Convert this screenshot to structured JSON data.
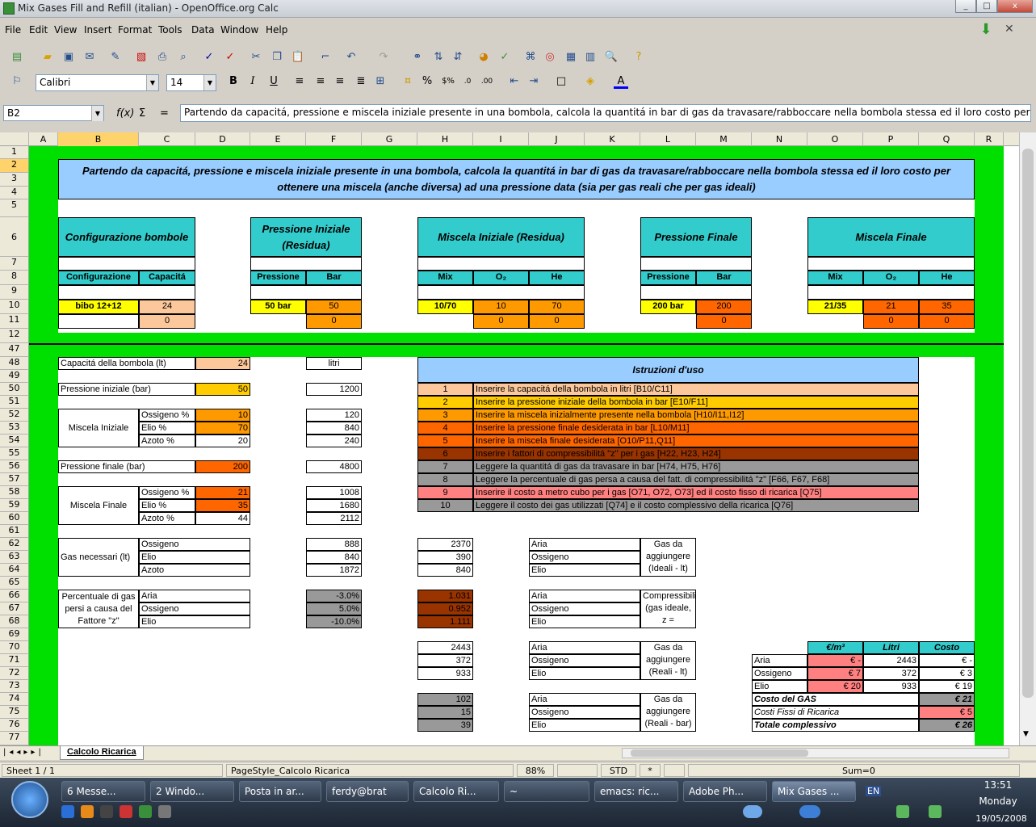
{
  "window": {
    "title": "Mix Gases Fill and Refill (italian) - OpenOffice.org Calc",
    "min": "_",
    "max": "□",
    "close": "x"
  },
  "menu": [
    "File",
    "Edit",
    "View",
    "Insert",
    "Format",
    "Tools",
    "Data",
    "Window",
    "Help"
  ],
  "toolbar2": {
    "font": "Calibri",
    "size": "14"
  },
  "formula": {
    "namebox": "B2",
    "fx": "f(x)",
    "sum": "Σ",
    "eq": "=",
    "content": "Partendo da capacitá, pressione e miscela iniziale presente in una bombola, calcola la quantitá in bar di gas da travasare/rabboccare nella bombola stessa ed il loro costo per ottenere una miscela (anc"
  },
  "columns": [
    "A",
    "B",
    "C",
    "D",
    "E",
    "F",
    "G",
    "H",
    "I",
    "J",
    "K",
    "L",
    "M",
    "N",
    "O",
    "P",
    "Q",
    "R"
  ],
  "rows": [
    "1",
    "2",
    "3",
    "4",
    "5",
    "6",
    "7",
    "8",
    "9",
    "10",
    "11",
    "12",
    "47",
    "48",
    "49",
    "50",
    "51",
    "52",
    "53",
    "54",
    "55",
    "56",
    "57",
    "58",
    "59",
    "60",
    "61",
    "62",
    "63",
    "64",
    "65",
    "66",
    "67",
    "68",
    "69",
    "70",
    "71",
    "72",
    "73",
    "74",
    "75",
    "76",
    "77"
  ],
  "sheet": {
    "title": "Partendo da capacitá, pressione e miscela iniziale presente in una bombola, calcola la quantitá in bar di gas da travasare/rabboccare nella bombola stessa ed il loro costo per ottenere una miscela (anche diversa) ad una pressione data (sia per gas reali che per gas ideali)",
    "conf": {
      "header": "Configurazione bombole",
      "col1": "Configurazione",
      "col2": "Capacitá",
      "v1": "bibo 12+12",
      "v2": "24",
      "v3": "0"
    },
    "pin": {
      "header": "Pressione Iniziale (Residua)",
      "col1": "Pressione",
      "col2": "Bar",
      "v1": "50 bar",
      "v2": "50",
      "v3": "0"
    },
    "min": {
      "header": "Miscela Iniziale (Residua)",
      "col1": "Mix",
      "col2": "O₂",
      "col3": "He",
      "v1": "10/70",
      "v2": "10",
      "v3": "70",
      "v4": "0",
      "v5": "0"
    },
    "pfin": {
      "header": "Pressione Finale",
      "col1": "Pressione",
      "col2": "Bar",
      "v1": "200 bar",
      "v2": "200",
      "v3": "0"
    },
    "mfin": {
      "header": "Miscela Finale",
      "col1": "Mix",
      "col2": "O₂",
      "col3": "He",
      "v1": "21/35",
      "v2": "21",
      "v3": "35",
      "v4": "0",
      "v5": "0"
    },
    "calc": {
      "cap_label": "Capacitá della bombola (lt)",
      "cap_val": "24",
      "litri": "litri",
      "pin_label": "Pressione iniziale (bar)",
      "pin_val": "50",
      "pin_l": "1200",
      "mi_label": "Miscela Iniziale",
      "mi": [
        [
          "Ossigeno %",
          "10",
          "120"
        ],
        [
          "Elio %",
          "70",
          "840"
        ],
        [
          "Azoto %",
          "20",
          "240"
        ]
      ],
      "pf_label": "Pressione finale (bar)",
      "pf_val": "200",
      "pf_l": "4800",
      "mf_label": "Miscela Finale",
      "mf": [
        [
          "Ossigeno %",
          "21",
          "1008"
        ],
        [
          "Elio %",
          "35",
          "1680"
        ],
        [
          "Azoto %",
          "44",
          "2112"
        ]
      ],
      "gn_label": "Gas necessari (lt)",
      "gn": [
        [
          "Ossigeno",
          "888"
        ],
        [
          "Elio",
          "840"
        ],
        [
          "Azoto",
          "1872"
        ]
      ],
      "perc_label": "Percentuale di gas persi a causa del Fattore \"z\"",
      "perc": [
        [
          "Aria",
          "-3.0%"
        ],
        [
          "Ossigeno",
          "5.0%"
        ],
        [
          "Elio",
          "-10.0%"
        ]
      ]
    },
    "gasi": {
      "vals": [
        "2370",
        "390",
        "840"
      ],
      "names": [
        "Aria",
        "Ossigeno",
        "Elio"
      ],
      "label": "Gas da aggiungere (Ideali - lt)"
    },
    "compz": {
      "vals": [
        "1.031",
        "0.952",
        "1.111"
      ],
      "names": [
        "Aria",
        "Ossigeno",
        "Elio"
      ],
      "label": "Compressibilitá (gas ideale, z ="
    },
    "gasr": {
      "vals": [
        "2443",
        "372",
        "933"
      ],
      "names": [
        "Aria",
        "Ossigeno",
        "Elio"
      ],
      "label": "Gas da aggiungere (Reali - lt)"
    },
    "gasb": {
      "vals": [
        "102",
        "15",
        "39"
      ],
      "names": [
        "Aria",
        "Ossigeno",
        "Elio"
      ],
      "label": "Gas da aggiungere (Reali - bar)"
    },
    "istr": {
      "header": "Istruzioni d'uso",
      "items": [
        [
          "1",
          "Inserire la capacitá della bombola in litri [B10/C11]"
        ],
        [
          "2",
          "Inserire la pressione iniziale della bombola in bar [E10/F11]"
        ],
        [
          "3",
          "Inserire la miscela inizialmente presente nella bombola [H10/I11,I12]"
        ],
        [
          "4",
          "Inserire la pressione finale desiderata in bar [L10/M11]"
        ],
        [
          "5",
          "Inserire la miscela finale desiderata [O10/P11,Q11]"
        ],
        [
          "6",
          "Inserire i fattori di compressibilitá \"z\" per i gas [H22, H23, H24]"
        ],
        [
          "7",
          "Leggere la quantitá di gas da travasare in bar [H74, H75, H76]"
        ],
        [
          "8",
          "Leggere la percentuale di gas persa a causa del fatt. di compressibilitá \"z\" [F66, F67, F68]"
        ],
        [
          "9",
          "Inserire il costo a metro cubo per i gas [O71, O72, O73] ed il costo fisso di ricarica [Q75]"
        ],
        [
          "10",
          "Leggere il costo dei gas utilizzati [Q74] e il costo complessivo della ricarica [Q76]"
        ]
      ]
    },
    "cost": {
      "h1": "€/m³",
      "h2": "Litri",
      "h3": "Costo",
      "rows": [
        [
          "Aria",
          "€ -",
          "2443",
          "€ -"
        ],
        [
          "Ossigeno",
          "€ 7",
          "372",
          "€ 3"
        ],
        [
          "Elio",
          "€ 20",
          "933",
          "€ 19"
        ]
      ],
      "gas_label": "Costo del GAS",
      "gas_val": "€ 21",
      "fix_label": "Costi Fissi di Ricarica",
      "fix_val": "€ 5",
      "tot_label": "Totale complessivo",
      "tot_val": "€ 26"
    }
  },
  "tabs": {
    "active": "Calcolo Ricarica"
  },
  "status": {
    "sheet": "Sheet 1 / 1",
    "style": "PageStyle_Calcolo Ricarica",
    "zoom": "88%",
    "mode": "STD",
    "mod": "*",
    "sum": "Sum=0"
  },
  "taskbar": {
    "items": [
      "6 Messe...",
      "2 Windo...",
      "Posta in ar...",
      "ferdy@brat",
      "Calcolo Ri...",
      "~",
      "emacs: ric...",
      "Adobe Ph...",
      "Mix Gases ..."
    ],
    "lang": "EN",
    "time": "13:51",
    "day": "Monday",
    "date": "19/05/2008"
  }
}
